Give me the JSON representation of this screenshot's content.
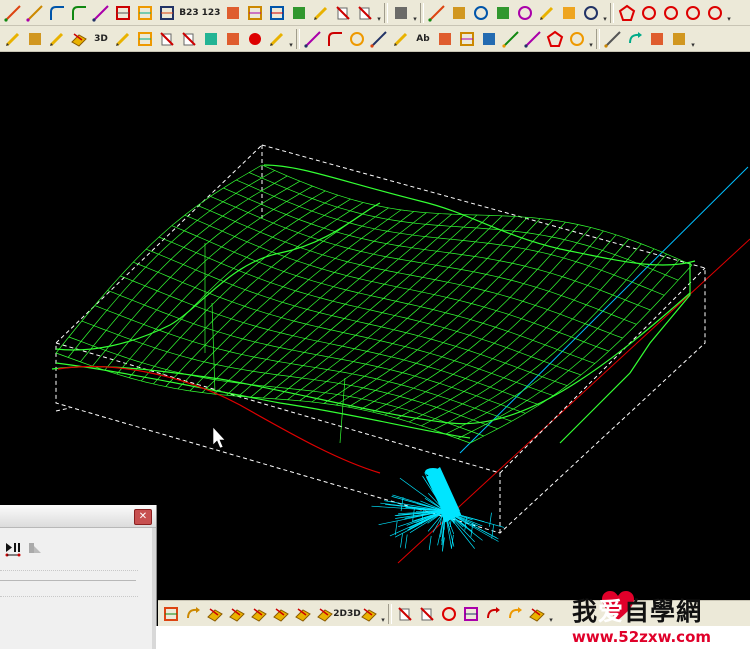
{
  "toolbar_top": {
    "icons": [
      "line-tool-icon",
      "corner-line-icon",
      "fillet-chamfer-icon",
      "arc-tool-icon",
      "rectangle-diagonal-icon",
      "box-grid-icon",
      "array-grid-icon",
      "bounding-box-icon",
      "text-b23-icon",
      "text-123-icon",
      "number-sequence-icon",
      "grid-squares-icon",
      "frame-icon",
      "insert-point-icon",
      "edit-flag-icon",
      "trim-icon",
      "extend-icon",
      "divider",
      "snap-mode-icon",
      "divider",
      "tangent-line-icon",
      "horizontal-snap-icon",
      "center-snap-icon",
      "intersection-snap-icon",
      "quadrant-snap-icon",
      "perpendicular-snap-icon",
      "parallel-snap-icon",
      "circle-snap-icon",
      "divider",
      "polygon-icon",
      "circle-icon",
      "gear-circle-icon",
      "spiral-icon",
      "ellipse-icon"
    ],
    "text_b23": "B23",
    "text_123": "123"
  },
  "toolbar_second": {
    "icons": [
      "pen-check-icon",
      "truck-icon",
      "wand-icon",
      "stack-icon",
      "3d-view-icon",
      "select-icon",
      "square-icon",
      "hammer-icon",
      "eraser-icon",
      "layer-icon",
      "dimension-icon",
      "red-dot-icon",
      "magic-wand-icon",
      "divider",
      "polyline-icon",
      "arc-icon",
      "circle-draw-icon",
      "rectangle-draw-icon",
      "node-edit-icon",
      "text-ab-icon",
      "text-style-icon",
      "grid-frame-icon",
      "calendar-icon",
      "spline-icon",
      "angle-icon",
      "diamond-icon",
      "gear-tool-icon",
      "divider",
      "curve-s-icon",
      "move-text-icon",
      "script-icon",
      "formula-icon"
    ],
    "text_ab": "Ab",
    "text_3d": "3D"
  },
  "toolbar_bottom": {
    "icons": [
      "box-3d-icon",
      "reverse-path-icon",
      "surface-pen-icon",
      "surface-layers-icon",
      "surface-shade-icon",
      "surface-cut-icon",
      "surface-s1-icon",
      "surface-s2-icon",
      "2d3d-toggle-icon",
      "surface-edit-icon",
      "divider",
      "copy-icon",
      "delete-icon",
      "record-icon",
      "frame-icon-b",
      "rotate-up-icon",
      "rotate-down-icon",
      "cut-icon"
    ],
    "text_2d3d": "2D3D"
  },
  "colors": {
    "toolpath": "#33ff33",
    "tool": "#00e5ff",
    "stock_box": "#ffffff",
    "axis_red": "#e00000",
    "axis_cyan": "#00bfff"
  },
  "watermark": {
    "title": "我爱自學網",
    "url": "www.52zxw.com"
  }
}
